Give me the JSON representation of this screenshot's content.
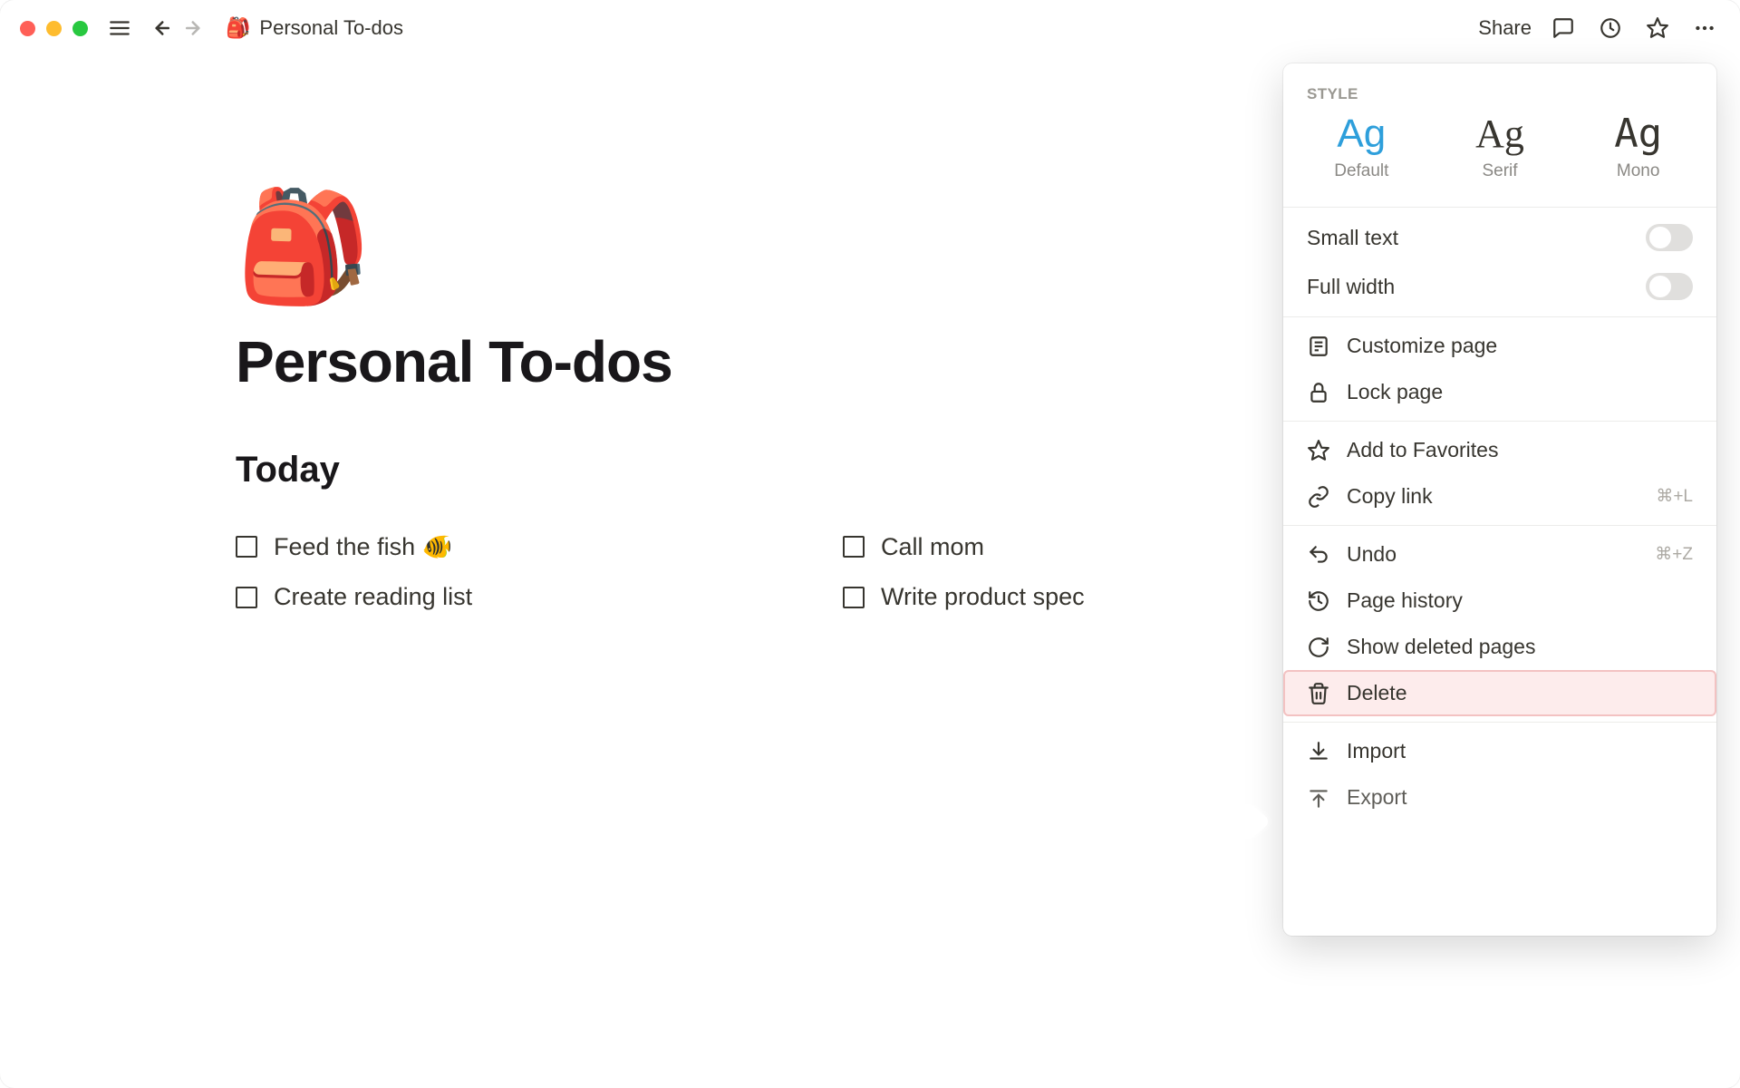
{
  "topbar": {
    "breadcrumb_icon": "🎒",
    "breadcrumb_title": "Personal To-dos",
    "share_label": "Share"
  },
  "page": {
    "icon": "🎒",
    "title": "Personal To-dos",
    "section_heading": "Today",
    "todos": [
      "Feed the fish 🐠",
      "Call mom",
      "Create reading list",
      "Write product spec"
    ]
  },
  "panel": {
    "style_header": "STYLE",
    "styles": [
      {
        "sample": "Ag",
        "label": "Default",
        "selected": true,
        "class": "default"
      },
      {
        "sample": "Ag",
        "label": "Serif",
        "selected": false,
        "class": "serif"
      },
      {
        "sample": "Ag",
        "label": "Mono",
        "selected": false,
        "class": "mono"
      }
    ],
    "toggles": {
      "small_text": "Small text",
      "full_width": "Full width"
    },
    "group_page": {
      "customize": "Customize page",
      "lock": "Lock page"
    },
    "group_link": {
      "favorites": "Add to Favorites",
      "copy_link": "Copy link",
      "copy_link_shortcut": "⌘+L"
    },
    "group_history": {
      "undo": "Undo",
      "undo_shortcut": "⌘+Z",
      "page_history": "Page history",
      "show_deleted": "Show deleted pages",
      "delete": "Delete"
    },
    "group_io": {
      "import": "Import",
      "export": "Export"
    }
  }
}
